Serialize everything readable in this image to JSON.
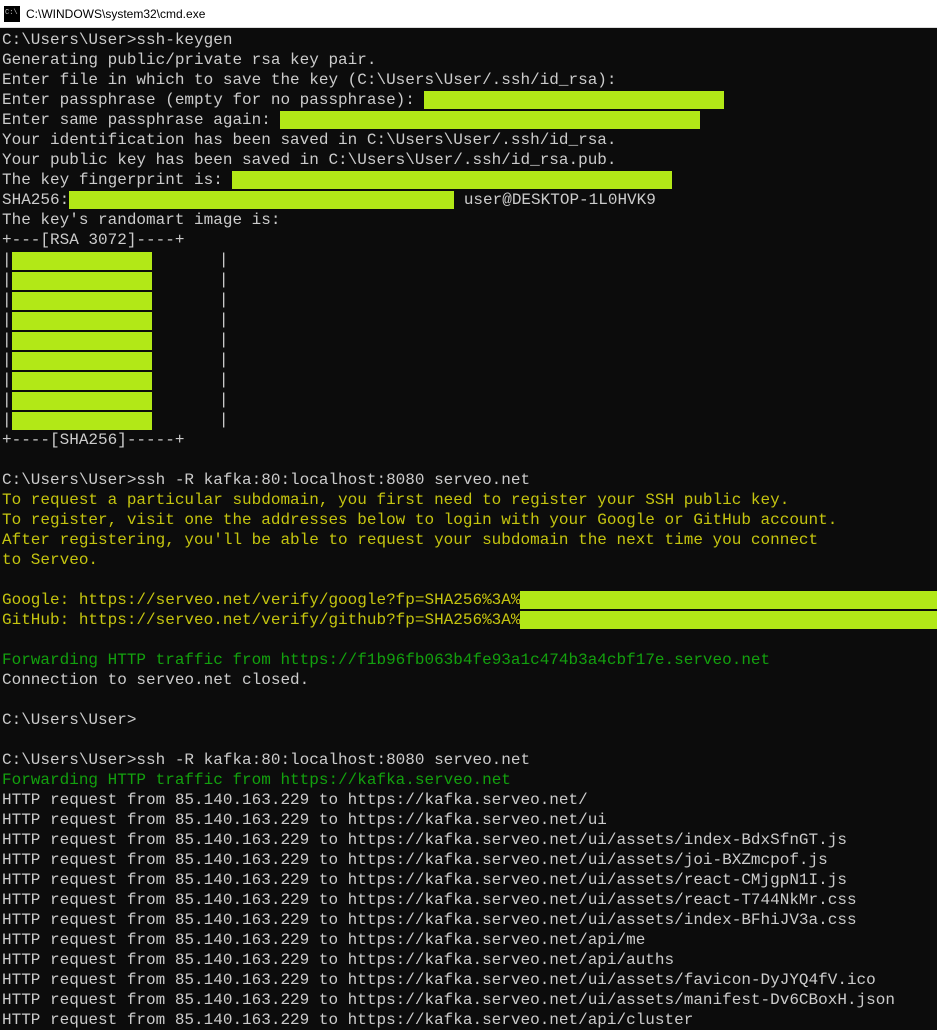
{
  "titlebar": {
    "title": "C:\\WINDOWS\\system32\\cmd.exe"
  },
  "session": {
    "prompt1": "C:\\Users\\User>ssh-keygen",
    "gen": "Generating public/private rsa key pair.",
    "enter_file": "Enter file in which to save the key (C:\\Users\\User/.ssh/id_rsa):",
    "enter_pass": "Enter passphrase (empty for no passphrase): ",
    "enter_pass2": "Enter same passphrase again: ",
    "saved_id": "Your identification has been saved in C:\\Users\\User/.ssh/id_rsa.",
    "saved_pub": "Your public key has been saved in C:\\Users\\User/.ssh/id_rsa.pub.",
    "fp_label": "The key fingerprint is: ",
    "sha_label": "SHA256:",
    "sha_tail": " user@DESKTOP-1L0HVK9",
    "art_hdr": "The key's randomart image is:",
    "art_top": "+---[RSA 3072]----+",
    "art_bot": "+----[SHA256]-----+",
    "prompt2": "C:\\Users\\User>ssh -R kafka:80:localhost:8080 serveo.net",
    "msg1": "To request a particular subdomain, you first need to register your SSH public key.",
    "msg2": "To register, visit one the addresses below to login with your Google or GitHub account.",
    "msg3": "After registering, you'll be able to request your subdomain the next time you connect",
    "msg4": "to Serveo.",
    "google": "Google: https://serveo.net/verify/google?fp=SHA256%3A%",
    "github": "GitHub: https://serveo.net/verify/github?fp=SHA256%3A%",
    "fwd1a": "Forwarding HTTP traffic from ",
    "fwd1b": "https://f1b96fb063b4fe93a1c474b3a4cbf17e.serveo.net",
    "closed": "Connection to serveo.net closed.",
    "prompt3": "C:\\Users\\User>",
    "prompt4": "C:\\Users\\User>ssh -R kafka:80:localhost:8080 serveo.net",
    "fwd2a": "Forwarding HTTP traffic from ",
    "fwd2b": "https://kafka.serveo.net",
    "req_prefix": "HTTP request from 85.140.163.229 to ",
    "requests": [
      "https://kafka.serveo.net/",
      "https://kafka.serveo.net/ui",
      "https://kafka.serveo.net/ui/assets/index-BdxSfnGT.js",
      "https://kafka.serveo.net/ui/assets/joi-BXZmcpof.js",
      "https://kafka.serveo.net/ui/assets/react-CMjgpN1I.js",
      "https://kafka.serveo.net/ui/assets/react-T744NkMr.css",
      "https://kafka.serveo.net/ui/assets/index-BFhiJV3a.css",
      "https://kafka.serveo.net/api/me",
      "https://kafka.serveo.net/api/auths",
      "https://kafka.serveo.net/ui/assets/favicon-DyJYQ4fV.ico",
      "https://kafka.serveo.net/ui/assets/manifest-Dv6CBoxH.json",
      "https://kafka.serveo.net/api/cluster"
    ]
  }
}
